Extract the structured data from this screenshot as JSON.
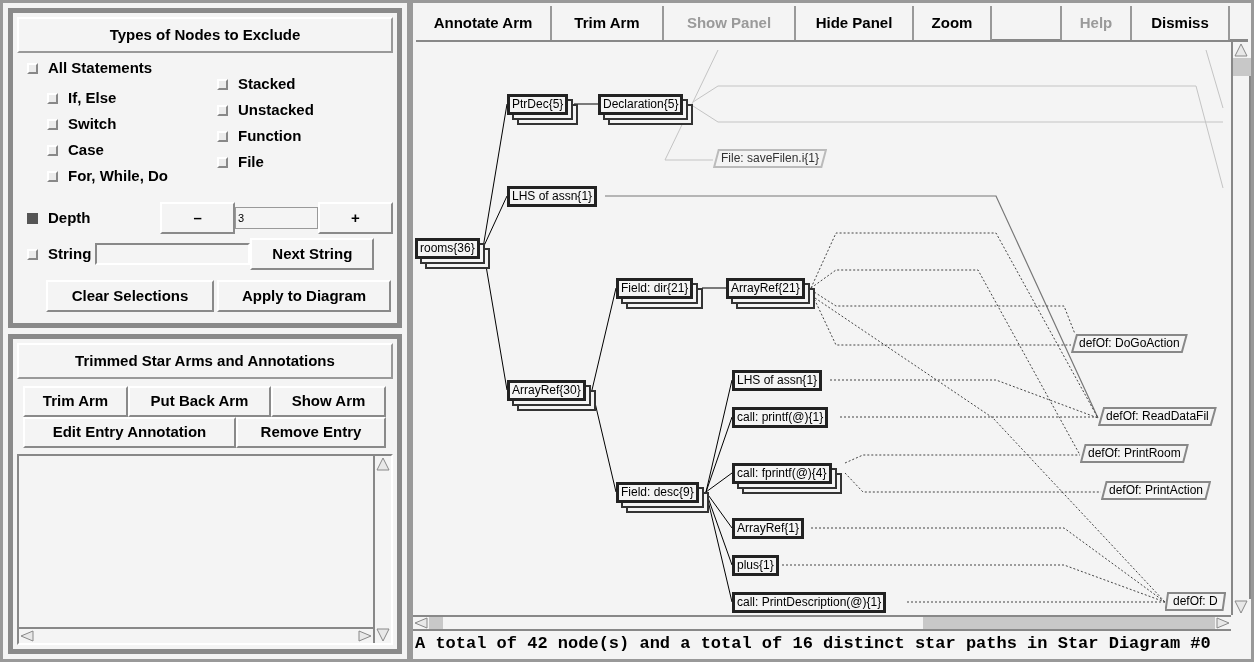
{
  "exclude_panel": {
    "title": "Types of Nodes to Exclude",
    "all_statements": {
      "label": "All Statements",
      "checked": false
    },
    "statement_types": [
      {
        "label": "If, Else",
        "checked": false
      },
      {
        "label": "Switch",
        "checked": false
      },
      {
        "label": "Case",
        "checked": false
      },
      {
        "label": "For, While, Do",
        "checked": false
      }
    ],
    "other_types": [
      {
        "label": "Stacked",
        "checked": false
      },
      {
        "label": "Unstacked",
        "checked": false
      },
      {
        "label": "Function",
        "checked": false
      },
      {
        "label": "File",
        "checked": false
      }
    ],
    "depth": {
      "label": "Depth",
      "checked": true,
      "decrement": "–",
      "value": "3",
      "increment": "+"
    },
    "string": {
      "label": "String",
      "checked": false,
      "next_button": "Next String"
    },
    "buttons": [
      "Clear Selections",
      "Apply to Diagram"
    ]
  },
  "annotations_panel": {
    "title": "Trimmed Star Arms and Annotations",
    "buttons_row_1": [
      "Trim Arm",
      "Put Back Arm",
      "Show Arm"
    ],
    "buttons_row_2": [
      "Edit Entry Annotation",
      "Remove Entry"
    ]
  },
  "toolbar_left": [
    {
      "label": "Annotate Arm",
      "disabled": false
    },
    {
      "label": "Trim Arm",
      "disabled": false
    },
    {
      "label": "Show Panel",
      "disabled": true
    },
    {
      "label": "Hide Panel",
      "disabled": false
    },
    {
      "label": "Zoom",
      "disabled": false
    }
  ],
  "toolbar_right": [
    {
      "label": "Help",
      "disabled": true
    },
    {
      "label": "Dismiss",
      "disabled": false
    }
  ],
  "diagram": {
    "nodes": [
      {
        "label": "PtrDec{5}",
        "kind": "stacked"
      },
      {
        "label": "Declaration{5}",
        "kind": "stacked"
      },
      {
        "label": "File: saveFilen.i{1}",
        "kind": "file"
      },
      {
        "label": "LHS of assn{1}",
        "kind": "single"
      },
      {
        "label": "rooms{36}",
        "kind": "stacked"
      },
      {
        "label": "Field: dir{21}",
        "kind": "stacked"
      },
      {
        "label": "ArrayRef{21}",
        "kind": "stacked"
      },
      {
        "label": "defOf: DoGoAction",
        "kind": "definition"
      },
      {
        "label": "LHS of assn{1}",
        "kind": "single"
      },
      {
        "label": "ArrayRef{30}",
        "kind": "stacked"
      },
      {
        "label": "call: printf(@){1}",
        "kind": "single"
      },
      {
        "label": "defOf: ReadDataFil",
        "kind": "definition"
      },
      {
        "label": "defOf: PrintRoom",
        "kind": "definition"
      },
      {
        "label": "call: fprintf(@){4}",
        "kind": "stacked"
      },
      {
        "label": "defOf: PrintAction",
        "kind": "definition"
      },
      {
        "label": "Field: desc{9}",
        "kind": "stacked"
      },
      {
        "label": "ArrayRef{1}",
        "kind": "single"
      },
      {
        "label": "plus{1}",
        "kind": "single"
      },
      {
        "label": "call: PrintDescription(@){1}",
        "kind": "single"
      },
      {
        "label": "defOf: D",
        "kind": "definition"
      }
    ]
  },
  "status_bar": "A total of 42 node(s) and a total of 16 distinct star paths in Star Diagram #0"
}
